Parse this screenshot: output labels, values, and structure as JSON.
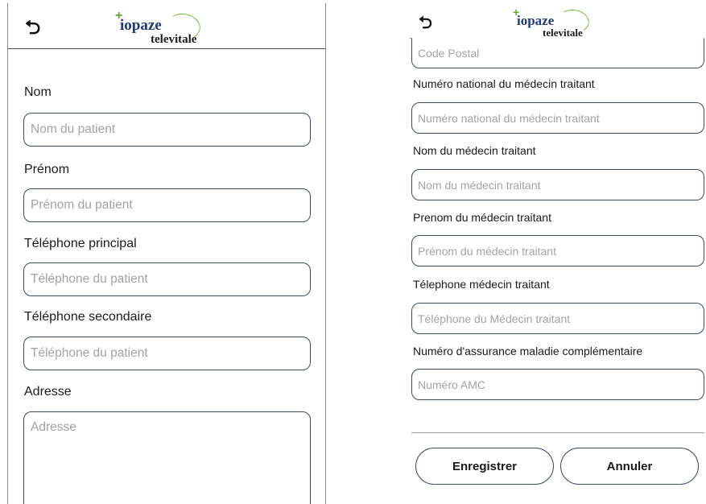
{
  "left_screen": {
    "logo": {
      "word1": "iopaze",
      "word2": "televitale",
      "mark": "+"
    },
    "fields": [
      {
        "label": "Nom",
        "placeholder": "Nom du patient"
      },
      {
        "label": "Prénom",
        "placeholder": "Prénom du patient"
      },
      {
        "label": "Téléphone principal",
        "placeholder": "Téléphone du patient"
      },
      {
        "label": "Téléphone secondaire",
        "placeholder": "Téléphone du patient"
      },
      {
        "label": "Adresse",
        "placeholder": "Adresse"
      }
    ]
  },
  "right_screen": {
    "logo": {
      "word1": "iopaze",
      "word2": "televitale",
      "mark": "+"
    },
    "top_field": {
      "placeholder": "Code Postal"
    },
    "fields": [
      {
        "label": "Numéro national du médecin traitant",
        "placeholder": "Numéro national du médecin traitant"
      },
      {
        "label": "Nom du médecin traitant",
        "placeholder": "Nom du médecin traitant"
      },
      {
        "label": "Prenom du médecin traitant",
        "placeholder": "Prénom du médecin traitant"
      },
      {
        "label": "Télephone médecin traitant",
        "placeholder": "Téléphone du Médecin traitant"
      },
      {
        "label": "Numéro d'assurance maladie complémentaire",
        "placeholder": "Numéro AMC"
      }
    ],
    "buttons": {
      "save": "Enregistrer",
      "cancel": "Annuler"
    }
  },
  "icons": {
    "back": "back-arrow-icon"
  },
  "colors": {
    "logo_blue": "#1f3a78",
    "logo_green": "#6cbf3c",
    "field_border": "#3d4a66"
  }
}
